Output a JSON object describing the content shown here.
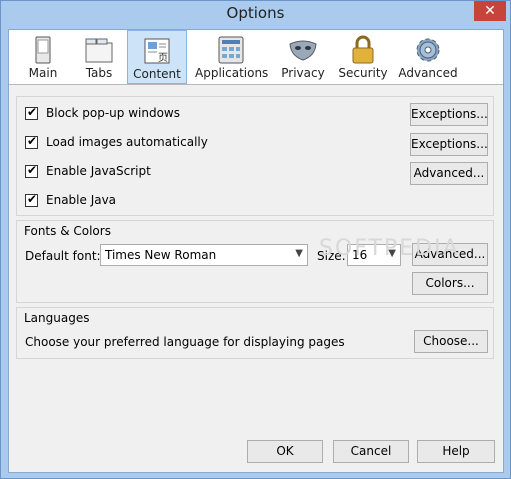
{
  "window": {
    "title": "Options",
    "close_glyph": "✕"
  },
  "toolbar": {
    "items": [
      {
        "label": "Main",
        "icon": "main-icon"
      },
      {
        "label": "Tabs",
        "icon": "tabs-icon"
      },
      {
        "label": "Content",
        "icon": "content-icon",
        "selected": true
      },
      {
        "label": "Applications",
        "icon": "applications-icon"
      },
      {
        "label": "Privacy",
        "icon": "privacy-icon"
      },
      {
        "label": "Security",
        "icon": "security-icon"
      },
      {
        "label": "Advanced",
        "icon": "advanced-icon"
      }
    ]
  },
  "content": {
    "checkboxes": [
      {
        "label": "Block pop-up windows",
        "checked": true,
        "button": "Exceptions..."
      },
      {
        "label": "Load images automatically",
        "checked": true,
        "button": "Exceptions..."
      },
      {
        "label": "Enable JavaScript",
        "checked": true,
        "button": "Advanced..."
      },
      {
        "label": "Enable Java",
        "checked": true,
        "button": ""
      }
    ],
    "check_glyph": "✔"
  },
  "fonts": {
    "heading": "Fonts & Colors",
    "default_font_label": "Default font:",
    "default_font_value": "Times New Roman",
    "size_label": "Size:",
    "size_value": "16",
    "advanced_button": "Advanced...",
    "colors_button": "Colors..."
  },
  "languages": {
    "heading": "Languages",
    "description": "Choose your preferred language for displaying pages",
    "choose_button": "Choose..."
  },
  "footer": {
    "ok": "OK",
    "cancel": "Cancel",
    "help": "Help"
  },
  "watermark": "SOFTPEDIA",
  "colors": {
    "selected_tab": "#cde3f7",
    "frame": "#aacbee"
  }
}
